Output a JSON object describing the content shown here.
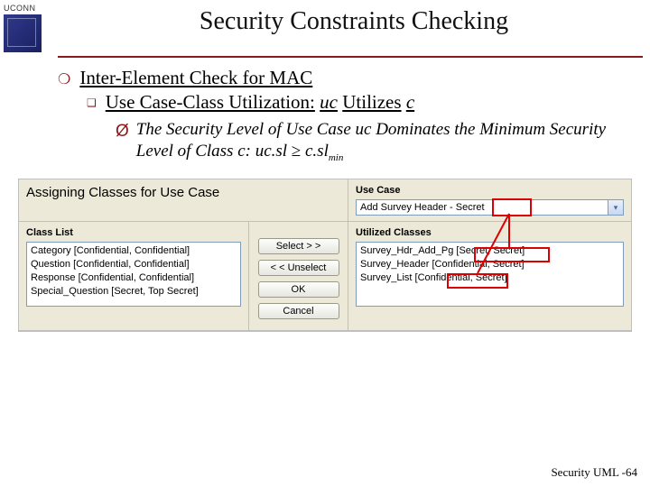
{
  "header": {
    "org": "UCONN",
    "title": "Security Constraints Checking"
  },
  "bullets": {
    "l1": "Inter-Element Check for MAC",
    "l2_a": "Use Case-Class Utilization:",
    "l2_b": "uc",
    "l2_c": "Utilizes",
    "l2_d": "c",
    "l3_a": "The Security Level of Use Case uc Dominates the Minimum Security Level of Class c: uc.sl",
    "l3_ge": "≥",
    "l3_b": "c.sl",
    "l3_sup": "min"
  },
  "panel": {
    "heading": "Assigning Classes for Use Case",
    "usecase_label": "Use Case",
    "usecase_value": "Add Survey Header - Secret",
    "classlist_label": "Class List",
    "classlist_items": [
      "Category [Confidential, Confidential]",
      "Question [Confidential, Confidential]",
      "Response [Confidential, Confidential]",
      "Special_Question [Secret, Top Secret]"
    ],
    "utilized_label": "Utilized Classes",
    "utilized_items": [
      "Survey_Hdr_Add_Pg [Secret, Secret]",
      "Survey_Header [Confidential, Secret]",
      "Survey_List [Confidential, Secret]"
    ],
    "buttons": {
      "select": "Select > >",
      "unselect": "< < Unselect",
      "ok": "OK",
      "cancel": "Cancel"
    }
  },
  "footer": "Security UML -64"
}
